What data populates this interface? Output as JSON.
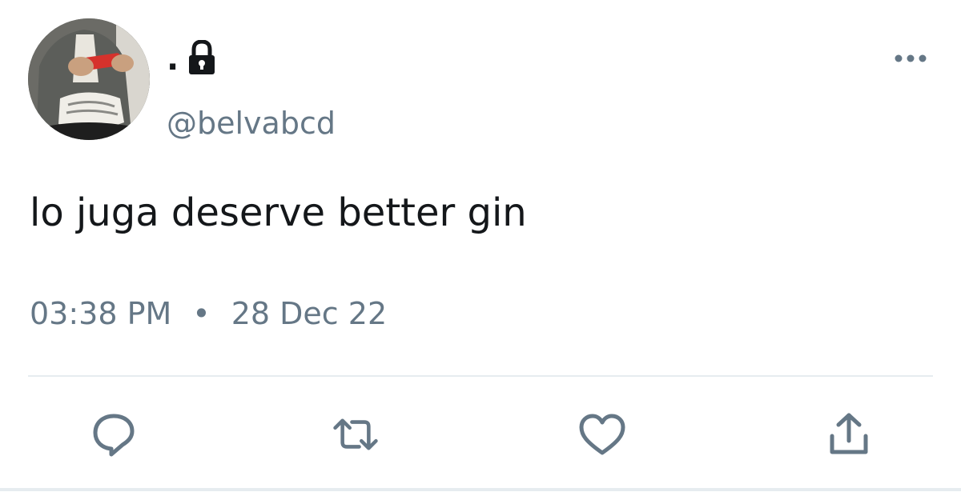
{
  "author": {
    "display_name": ".",
    "handle": "@belvabcd",
    "protected": true,
    "avatar_icon": "avatar-photo"
  },
  "tweet": {
    "text": "lo juga deserve better gin",
    "time": "03:38 PM",
    "separator": "•",
    "date": "28 Dec 22"
  },
  "actions": {
    "reply_icon": "reply-icon",
    "retweet_icon": "retweet-icon",
    "like_icon": "heart-icon",
    "share_icon": "share-icon",
    "more_icon": "more-options-icon"
  },
  "colors": {
    "text_primary": "#14171a",
    "text_secondary": "#657786",
    "icon": "#657786",
    "divider": "#e6ecf0"
  }
}
